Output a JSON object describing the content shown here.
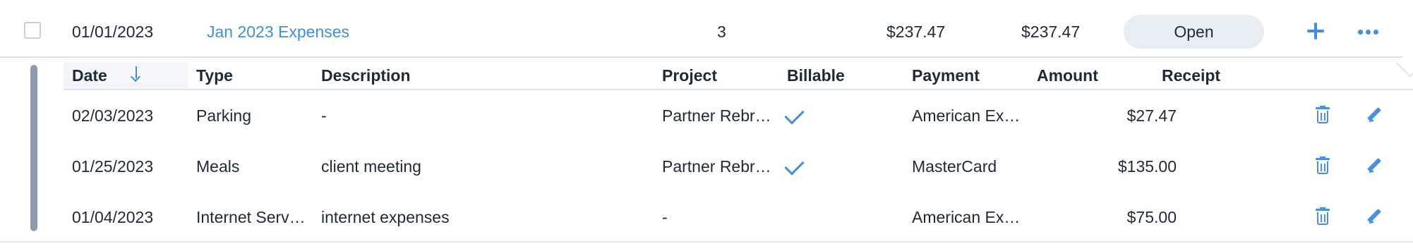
{
  "report": {
    "date": "01/01/2023",
    "name": "Jan 2023 Expenses",
    "count": "3",
    "total": "$237.47",
    "amount_due": "$237.47",
    "status": "Open"
  },
  "headers": {
    "date": "Date",
    "type": "Type",
    "description": "Description",
    "project": "Project",
    "billable": "Billable",
    "payment": "Payment",
    "amount": "Amount",
    "receipt": "Receipt"
  },
  "expenses": [
    {
      "date": "02/03/2023",
      "type": "Parking",
      "description": "-",
      "project": "Partner Rebr…",
      "billable": true,
      "payment": "American Ex…",
      "amount": "$27.47"
    },
    {
      "date": "01/25/2023",
      "type": "Meals",
      "description": "client meeting",
      "project": "Partner Rebr…",
      "billable": true,
      "payment": "MasterCard",
      "amount": "$135.00"
    },
    {
      "date": "01/04/2023",
      "type": "Internet Serv…",
      "description": "internet expenses",
      "project": "-",
      "billable": false,
      "payment": "American Ex…",
      "amount": "$75.00"
    }
  ],
  "colors": {
    "accent": "#3f8fdd",
    "status_pill": "#e8edf2",
    "side_bar": "#8e9aae"
  },
  "icons": {
    "add": "plus-icon",
    "more": "ellipsis-icon",
    "sort": "arrow-down-icon",
    "billable": "checkmark-icon",
    "delete": "trash-icon",
    "edit": "pencil-icon"
  }
}
